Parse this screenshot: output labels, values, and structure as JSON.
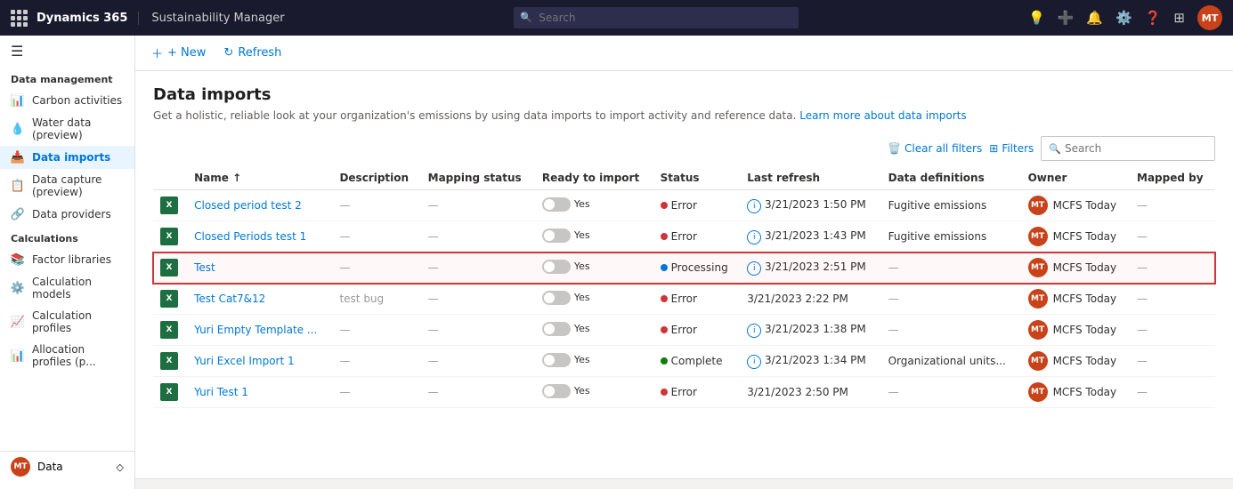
{
  "topnav": {
    "brand": "Dynamics 365",
    "app": "Sustainability Manager",
    "search_placeholder": "Search"
  },
  "toolbar": {
    "new_label": "+ New",
    "refresh_label": "Refresh"
  },
  "page": {
    "title": "Data imports",
    "description": "Get a holistic, reliable look at your organization's emissions by using data imports to import activity and reference data.",
    "learn_more": "Learn more about data imports"
  },
  "table_controls": {
    "clear_filters": "Clear all filters",
    "filters": "Filters",
    "search_placeholder": "Search"
  },
  "table": {
    "columns": [
      "Name ↑",
      "Description",
      "Mapping status",
      "Ready to import",
      "Status",
      "Last refresh",
      "Data definitions",
      "Owner",
      "Mapped by"
    ],
    "rows": [
      {
        "name": "Closed period test 2",
        "description": "—",
        "mapping_status": "—",
        "ready": "Yes",
        "status": "Error",
        "status_type": "error",
        "last_refresh": "3/21/2023 1:50 PM",
        "has_info": true,
        "data_definitions": "Fugitive emissions",
        "owner": "MT",
        "owner_name": "MCFS Today",
        "mapped_by": "—",
        "selected": false
      },
      {
        "name": "Closed Periods test 1",
        "description": "—",
        "mapping_status": "—",
        "ready": "Yes",
        "status": "Error",
        "status_type": "error",
        "last_refresh": "3/21/2023 1:43 PM",
        "has_info": true,
        "data_definitions": "Fugitive emissions",
        "owner": "MT",
        "owner_name": "MCFS Today",
        "mapped_by": "—",
        "selected": false
      },
      {
        "name": "Test",
        "description": "—",
        "mapping_status": "—",
        "ready": "Yes",
        "status": "Processing",
        "status_type": "processing",
        "last_refresh": "3/21/2023 2:51 PM",
        "has_info": true,
        "data_definitions": "—",
        "owner": "MT",
        "owner_name": "MCFS Today",
        "mapped_by": "—",
        "selected": true
      },
      {
        "name": "Test Cat7&12",
        "description": "test bug",
        "mapping_status": "—",
        "ready": "Yes",
        "status": "Error",
        "status_type": "error",
        "last_refresh": "3/21/2023 2:22 PM",
        "has_info": false,
        "data_definitions": "—",
        "owner": "MT",
        "owner_name": "MCFS Today",
        "mapped_by": "—",
        "selected": false
      },
      {
        "name": "Yuri Empty Template ...",
        "description": "—",
        "mapping_status": "—",
        "ready": "Yes",
        "status": "Error",
        "status_type": "error",
        "last_refresh": "3/21/2023 1:38 PM",
        "has_info": true,
        "data_definitions": "—",
        "owner": "MT",
        "owner_name": "MCFS Today",
        "mapped_by": "—",
        "selected": false
      },
      {
        "name": "Yuri Excel Import 1",
        "description": "—",
        "mapping_status": "—",
        "ready": "Yes",
        "status": "Complete",
        "status_type": "complete",
        "last_refresh": "3/21/2023 1:34 PM",
        "has_info": true,
        "data_definitions": "Organizational units...",
        "owner": "MT",
        "owner_name": "MCFS Today",
        "mapped_by": "—",
        "selected": false
      },
      {
        "name": "Yuri Test 1",
        "description": "—",
        "mapping_status": "—",
        "ready": "Yes",
        "status": "Error",
        "status_type": "error",
        "last_refresh": "3/21/2023 2:50 PM",
        "has_info": false,
        "data_definitions": "—",
        "owner": "MT",
        "owner_name": "MCFS Today",
        "mapped_by": "—",
        "selected": false
      }
    ]
  },
  "sidebar": {
    "hamburger": "☰",
    "sections": [
      {
        "label": "Data management",
        "items": [
          {
            "id": "carbon-activities",
            "label": "Carbon activities",
            "icon": "📊"
          },
          {
            "id": "water-data",
            "label": "Water data (preview)",
            "icon": "💧"
          },
          {
            "id": "data-imports",
            "label": "Data imports",
            "icon": "📥",
            "active": true
          },
          {
            "id": "data-capture",
            "label": "Data capture (preview)",
            "icon": "📋"
          },
          {
            "id": "data-providers",
            "label": "Data providers",
            "icon": "🔗"
          }
        ]
      },
      {
        "label": "Calculations",
        "items": [
          {
            "id": "factor-libraries",
            "label": "Factor libraries",
            "icon": "📚"
          },
          {
            "id": "calculation-models",
            "label": "Calculation models",
            "icon": "⚙️"
          },
          {
            "id": "calculation-profiles",
            "label": "Calculation profiles",
            "icon": "📈"
          },
          {
            "id": "allocation-profiles",
            "label": "Allocation profiles (p...",
            "icon": "📊"
          }
        ]
      }
    ],
    "bottom": {
      "label": "Data",
      "icon": "MT"
    }
  },
  "colors": {
    "accent": "#0078d4",
    "error": "#d13438",
    "processing": "#0078d4",
    "complete": "#107c10",
    "selected_border": "#d13438"
  }
}
